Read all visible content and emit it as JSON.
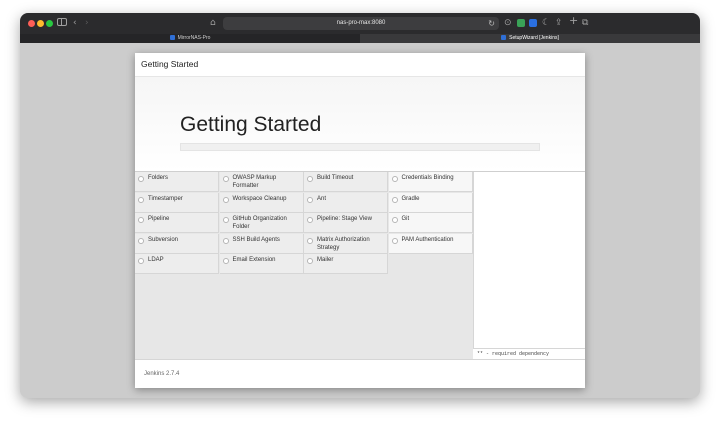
{
  "browser": {
    "url": "nas-pro-max:8080",
    "tabs": [
      {
        "label": "MirrorNAS-Pro",
        "active": false
      },
      {
        "label": "SetupWizard [Jenkins]",
        "active": true
      }
    ]
  },
  "dialog": {
    "header_title": "Getting Started",
    "hero_title": "Getting Started",
    "plugins": [
      [
        "Folders",
        "OWASP Markup Formatter",
        "Build Timeout",
        "Credentials Binding"
      ],
      [
        "Timestamper",
        "Workspace Cleanup",
        "Ant",
        "Gradle"
      ],
      [
        "Pipeline",
        "GitHub Organization Folder",
        "Pipeline: Stage View",
        "Git"
      ],
      [
        "Subversion",
        "SSH Build Agents",
        "Matrix Authorization Strategy",
        "PAM Authentication"
      ],
      [
        "LDAP",
        "Email Extension",
        "Mailer"
      ]
    ],
    "required_note": "** - required dependency",
    "version": "Jenkins 2.7.4"
  },
  "colors": {
    "accent": "#2f6fd6",
    "red": "#ff5f57",
    "yellow": "#febc2e",
    "green": "#28c840"
  }
}
